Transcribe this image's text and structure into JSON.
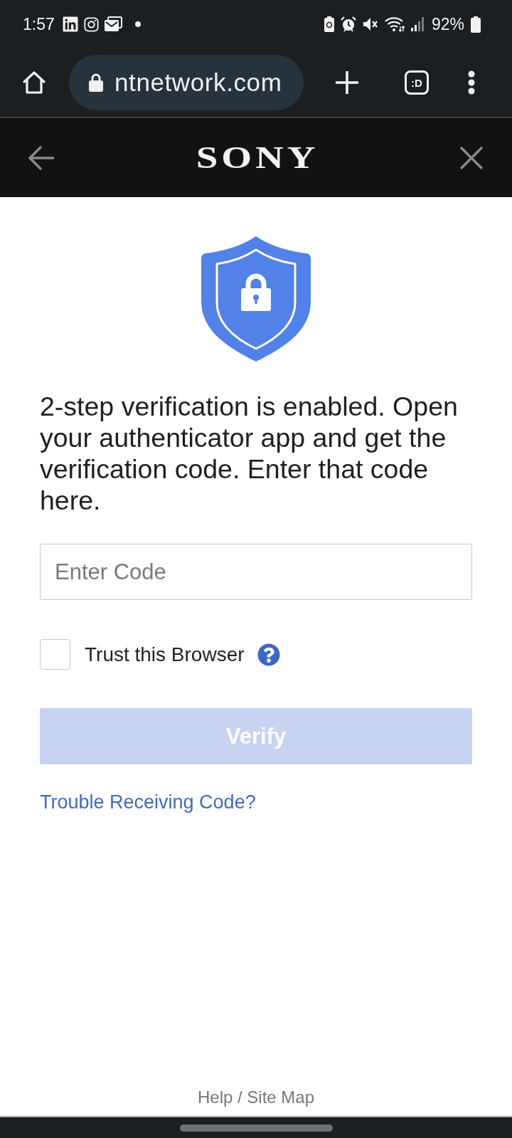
{
  "status_bar": {
    "time": "1:57",
    "battery": "92%"
  },
  "browser_toolbar": {
    "url": "ntnetwork.com",
    "tab_switcher": ":D"
  },
  "site_header": {
    "logo": "SONY"
  },
  "verification": {
    "message": "2-step verification is enabled. Open your authenticator app and get the verification code. Enter that code here.",
    "code_field": {
      "placeholder": "Enter Code"
    },
    "trust_browser": {
      "label": "Trust this Browser",
      "checked": false
    },
    "verify_button": {
      "label": "Verify",
      "disabled": true
    },
    "trouble_link": "Trouble Receiving Code?"
  },
  "footer": {
    "link": "Help / Site Map"
  }
}
